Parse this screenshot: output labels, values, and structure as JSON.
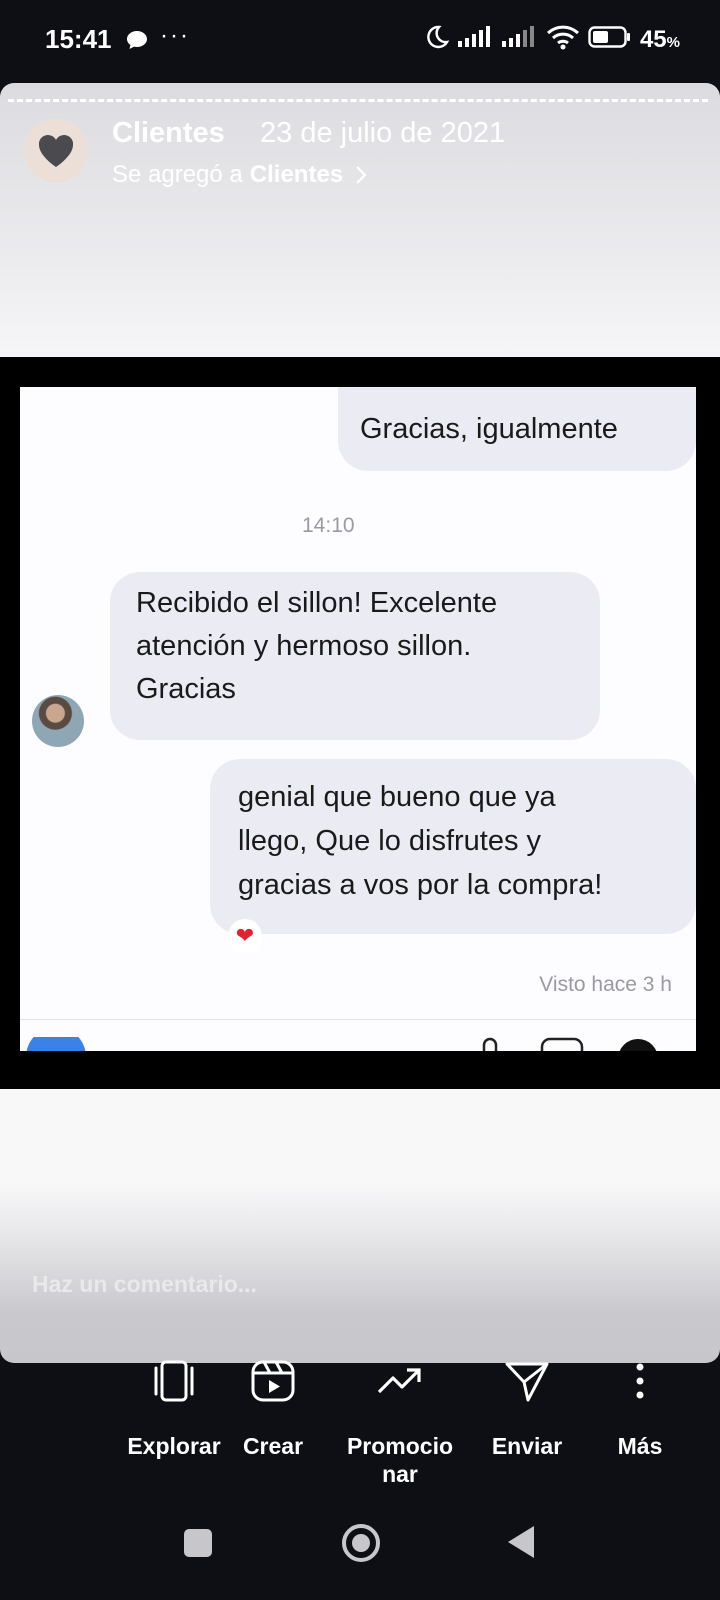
{
  "status_bar": {
    "time": "15:41",
    "notification_dots": "···",
    "battery_percent": "45",
    "battery_unit": "%",
    "icons": [
      "chat-bubble-icon",
      "moon-icon",
      "signal-icon",
      "signal-icon",
      "wifi-icon",
      "battery-icon"
    ]
  },
  "story": {
    "user": "Clientes",
    "date": "23 de julio de 2021",
    "added_prefix": "Se agregó a",
    "added_highlight": "Clientes",
    "comment_placeholder": "Haz un comentario..."
  },
  "chat": {
    "messages": [
      {
        "side": "right",
        "text": "Gracias, igualmente"
      },
      {
        "side": "left",
        "lines": [
          "Recibido el sillon!  Excelente",
          "atención y hermoso sillon.",
          "Gracias"
        ]
      },
      {
        "side": "right",
        "lines": [
          "genial que bueno que ya",
          "llego, Que lo disfrutes y",
          "gracias a vos por la compra!"
        ]
      }
    ],
    "timestamp": "14:10",
    "seen": "Visto hace 3 h",
    "reaction": "❤"
  },
  "actions": [
    {
      "label": "Explorar",
      "icon": "explore-icon"
    },
    {
      "label": "Crear",
      "icon": "create-reel-icon"
    },
    {
      "label_line1": "Promocio",
      "label_line2": "nar",
      "icon": "trending-up-icon"
    },
    {
      "label": "Enviar",
      "icon": "send-icon"
    },
    {
      "label": "Más",
      "icon": "more-vertical-icon"
    }
  ],
  "nav": [
    "recents-icon",
    "home-icon",
    "back-icon"
  ],
  "colors": {
    "background": "#0d0f14",
    "bubble": "#ebebf4",
    "heart": "#e0232f"
  }
}
